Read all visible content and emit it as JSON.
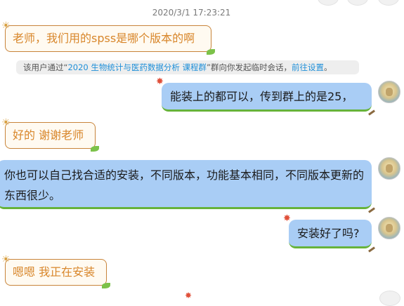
{
  "chat": {
    "timestamp": "2020/3/1 17:23:21",
    "system_notice": {
      "prefix": "该用户通过“",
      "group_name": "2020 生物统计与医药数据分析 课程群",
      "middle": "”群向你发起临时会话，",
      "link": "前往设置",
      "suffix": "。"
    },
    "messages": [
      {
        "side": "left",
        "text": "老师，我们用的spss是哪个版本的啊"
      },
      {
        "side": "right",
        "text": "能装上的都可以，传到群上的是25，"
      },
      {
        "side": "left",
        "text": "好的 谢谢老师"
      },
      {
        "side": "right",
        "text": "你也可以自己找合适的安装，不同版本，功能基本相同，不同版本更新的东西很少。"
      },
      {
        "side": "right",
        "text": "安装好了吗?"
      },
      {
        "side": "left",
        "text": "嗯嗯 我正在安装"
      }
    ]
  },
  "colors": {
    "left_bubble_border": "#c8843a",
    "left_bubble_text": "#d8862a",
    "right_bubble_bg": "#a9cdf5",
    "right_bubble_accent": "#67b33a",
    "link": "#1f8fd8"
  },
  "icons": {
    "left_bubble_decoration": "sun-icon",
    "right_bubble_decoration": "pinwheel-icon",
    "avatar": "teacher-avatar"
  }
}
